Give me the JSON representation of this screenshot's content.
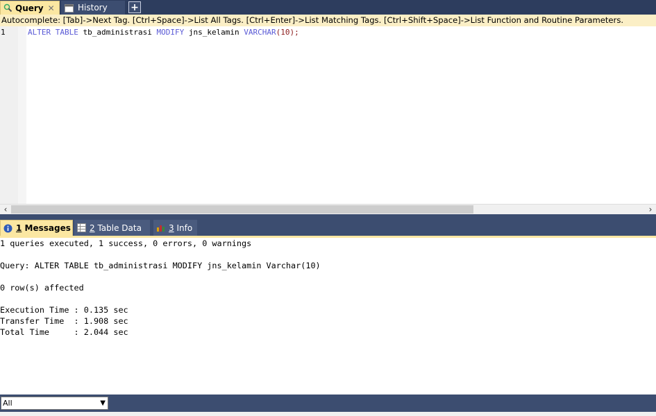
{
  "tabs": {
    "query_label": "Query",
    "history_label": "History",
    "close_glyph": "✕",
    "add_glyph": "+",
    "history_icon_text": "18"
  },
  "autocomplete": {
    "text": "Autocomplete: [Tab]->Next Tag. [Ctrl+Space]->List All Tags. [Ctrl+Enter]->List Matching Tags. [Ctrl+Shift+Space]->List Function and Routine Parameters."
  },
  "editor": {
    "line_number": "1",
    "code": {
      "kw1": "ALTER TABLE",
      "t1": " tb_administrasi ",
      "kw2": "MODIFY",
      "t2": " jns_kelamin ",
      "kw3": "VARCHAR",
      "t3": "(",
      "num": "10",
      "t4": ");"
    }
  },
  "result_tabs": {
    "messages_num": "1",
    "messages_label": " Messages",
    "tabledata_num": "2",
    "tabledata_label": " Table Data",
    "info_num": "3",
    "info_label": " Info"
  },
  "messages": [
    "1 queries executed, 1 success, 0 errors, 0 warnings",
    "Query: ALTER TABLE tb_administrasi MODIFY jns_kelamin Varchar(10)",
    "0 row(s) affected",
    "Execution Time : 0.135 sec",
    "Transfer Time  : 1.908 sec",
    "Total Time     : 2.044 sec"
  ],
  "filter": {
    "selected": "All"
  },
  "colors": {
    "chrome": "#3c4d70",
    "active_tab": "#fbe7a2",
    "keyword": "#5a5ad6"
  }
}
